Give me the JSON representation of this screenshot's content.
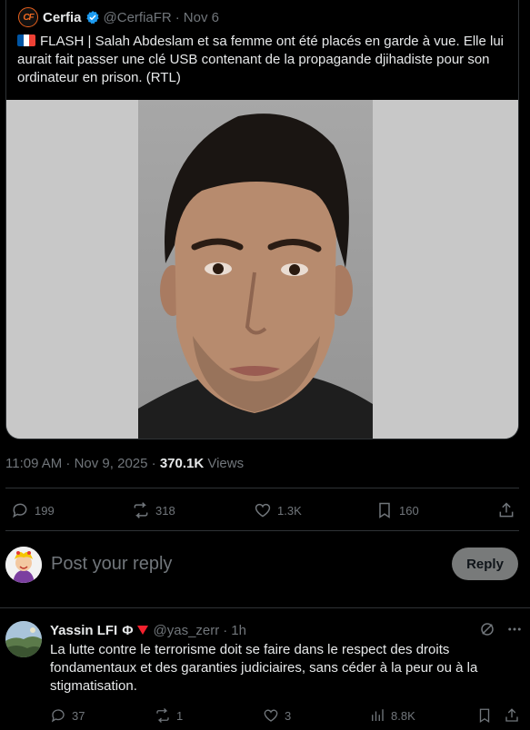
{
  "quote": {
    "name": "Cerfia",
    "handle": "@CerfiaFR",
    "sep": "·",
    "date": "Nov 6",
    "avatar_text": "CF",
    "text": "FLASH | Salah Abdeslam et sa femme ont été placés en garde à vue. Elle lui aurait fait passer une clé USB contenant de la propagande djihadiste pour son ordinateur en prison. (RTL)",
    "image_icon": "mugshot-photo"
  },
  "meta": {
    "time": "11:09 AM · Nov 9, 2025 · ",
    "views_count": "370.1K",
    "views_label": " Views"
  },
  "actions": {
    "replies": "199",
    "reposts": "318",
    "likes": "1.3K",
    "bookmarks": "160"
  },
  "composer": {
    "placeholder": "Post your reply",
    "button": "Reply"
  },
  "reply": {
    "name": "Yassin LFI",
    "name_suffix": "Φ",
    "handle": "@yas_zerr",
    "sep": "·",
    "time": "1h",
    "text": "La lutte contre le terrorisme doit se faire dans le respect des droits fondamentaux et des garanties judiciaires, sans céder à la peur ou à la stigmatisation.",
    "replies": "37",
    "reposts": "1",
    "likes": "3",
    "views": "8.8K"
  },
  "colors": {
    "verified": "#1d9bf0",
    "triangle": "#f4212e",
    "muted": "#71767b"
  }
}
